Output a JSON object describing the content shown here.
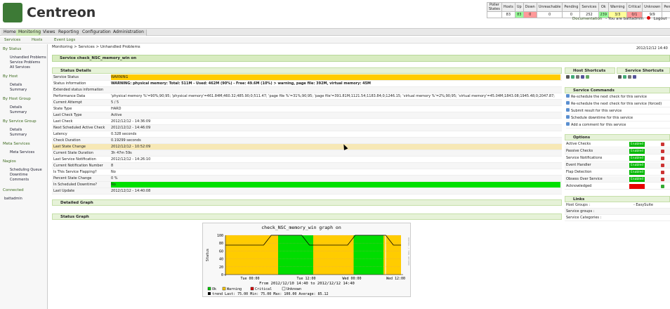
{
  "brand": {
    "name": "Centreon",
    "color": "#3d7a36"
  },
  "poller": {
    "headers": [
      "Poller States",
      "Hosts",
      "Up",
      "Down",
      "Unreachable",
      "Pending",
      "Services",
      "Ok",
      "Warning",
      "Critical",
      "Unknown",
      "Pending"
    ],
    "values": [
      "",
      "83",
      "83",
      "0",
      "0",
      "0",
      "252",
      "239",
      "3/3",
      "0/1",
      "9/9",
      "0"
    ]
  },
  "topbar": {
    "documentation": "Documentation",
    "you_are": "- You are battadmin",
    "logout": "Logout"
  },
  "menu": [
    "Home",
    "Monitoring",
    "Views",
    "Reporting",
    "Configuration",
    "Administration"
  ],
  "submenu": [
    "Services",
    "Hosts",
    "Event Logs"
  ],
  "sidebar": {
    "sections": [
      {
        "title": "By Status",
        "items": [
          "Unhandled Problems",
          "Service Problems",
          "All Services"
        ]
      },
      {
        "title": "By Host",
        "items": [
          "Details",
          "Summary"
        ]
      },
      {
        "title": "By Host Group",
        "items": [
          "Details",
          "Summary"
        ]
      },
      {
        "title": "By Service Group",
        "items": [
          "Details",
          "Summary"
        ]
      },
      {
        "title": "Meta Services",
        "items": [
          "Meta Services"
        ]
      },
      {
        "title": "Nagios",
        "items": [
          "Scheduling Queue",
          "Downtime",
          "Comments"
        ]
      }
    ],
    "connected": "Connected",
    "user": "battadmin"
  },
  "breadcrumb": "Monitoring > Services > Unhandled Problems",
  "datetime": "2012/12/12 14:40",
  "service_title": "Service check_NSC_memory_win on",
  "status_details": {
    "title": "Status Details",
    "rows": [
      {
        "k": "Service Status",
        "v": "WARNING",
        "style": "yellow"
      },
      {
        "k": "Status information",
        "v": "WARNING: physical memory: Total: 511M - Used: 462M (90%) - Free: 49.6M (10%) > warning, page file: 392M, virtual memory: 45M",
        "style": "w"
      },
      {
        "k": "Extended status information",
        "v": "",
        "style": "g"
      },
      {
        "k": "Performance Data",
        "v": "'physical memory %'=90%;90;95; 'physical memory'=461.84M;460.32;485.90;0;511.47; 'page file %'=31%;90;95; 'page file'=391.81M;1121.54;1183.84;0;1246.15; 'virtual memory %'=2%;90;95; 'virtual memory'=45.04M;1843.08;1945.48;0;2047.87;",
        "style": "w"
      },
      {
        "k": "Current Attempt",
        "v": "5 / 5",
        "style": "g"
      },
      {
        "k": "State Type",
        "v": "HARD",
        "style": "w"
      },
      {
        "k": "Last Check Type",
        "v": "Active",
        "style": "g"
      },
      {
        "k": "Last Check",
        "v": "2012/12/12 - 14:36:09",
        "style": "w"
      },
      {
        "k": "Next Scheduled Active Check",
        "v": "2012/12/12 - 14:46:09",
        "style": "g"
      },
      {
        "k": "Latency",
        "v": "0.328 seconds",
        "style": "w"
      },
      {
        "k": "Check Duration",
        "v": "0.19299 seconds",
        "style": "g"
      },
      {
        "k": "Last State Change",
        "v": "2012/12/12 - 10:52:09",
        "style": "yel2"
      },
      {
        "k": "Current State Duration",
        "v": "3h 47m 59s",
        "style": "g"
      },
      {
        "k": "Last Service Notification",
        "v": "2012/12/12 - 14:26:10",
        "style": "w"
      },
      {
        "k": "Current Notification Number",
        "v": "8",
        "style": "g"
      },
      {
        "k": "Is This Service Flapping?",
        "v": "No",
        "style": "w"
      },
      {
        "k": "Percent State Change",
        "v": "0 %",
        "style": "g"
      },
      {
        "k": "In Scheduled Downtime?",
        "v": "No",
        "style": "green"
      },
      {
        "k": "Last Update",
        "v": "2012/12/12 - 14:40:08",
        "style": "g"
      }
    ]
  },
  "detailed_graph": "Detailed Graph",
  "status_graph": "Status Graph",
  "host_shortcuts": "Host Shortcuts",
  "service_shortcuts": "Service Shortcuts",
  "service_commands": {
    "title": "Service Commands",
    "items": [
      "Re-schedule the next check for this service",
      "Re-schedule the next check for this service (forced)",
      "Submit result for this service",
      "Schedule downtime for this service",
      "Add a comment for this service"
    ]
  },
  "options": {
    "title": "Options",
    "items": [
      {
        "k": "Active Checks",
        "v": "Enabled",
        "on": true
      },
      {
        "k": "Passive Checks",
        "v": "Enabled",
        "on": true
      },
      {
        "k": "Service Notifications",
        "v": "Enabled",
        "on": true
      },
      {
        "k": "Event Handler",
        "v": "Enabled",
        "on": true
      },
      {
        "k": "Flap Detection",
        "v": "Enabled",
        "on": true
      },
      {
        "k": "Obsess Over Service",
        "v": "Enabled",
        "on": true
      },
      {
        "k": "Acknowledged",
        "v": "",
        "on": false
      }
    ]
  },
  "links": {
    "title": "Links",
    "items": [
      {
        "k": "Host Groups :",
        "v": "- EasySuite"
      },
      {
        "k": "Service groups :",
        "v": ""
      },
      {
        "k": "Service Categories :",
        "v": ""
      }
    ]
  },
  "graph": {
    "title": "check_NSC_memory_win graph on",
    "ylabel": "Status",
    "yticks": [
      "100",
      "80",
      "60",
      "40",
      "20",
      "0"
    ],
    "xticks": [
      "Tue 00:00",
      "Tue 12:00",
      "Wed 00:00",
      "Wed 12:00"
    ],
    "side_text": "RRDTOOL / TOBI OETIKER",
    "from_to": "From 2012/12/10 14:40 to 2012/12/12 14:40",
    "legend": [
      {
        "name": "Ok",
        "color": "#00cc00"
      },
      {
        "name": "Warning",
        "color": "#ffcc00"
      },
      {
        "name": "Critical",
        "color": "#dd0000"
      },
      {
        "name": "Unknown",
        "color": "#ffffff"
      }
    ],
    "trend": "trend   Last:   75.00   Min:   75.00   Max:  100.00   Average:   85.12"
  },
  "chart_data": {
    "type": "area",
    "ylim": [
      0,
      100
    ],
    "segments": [
      {
        "from": 0.0,
        "to": 0.3,
        "state": "Warning"
      },
      {
        "from": 0.3,
        "to": 0.5,
        "state": "Ok"
      },
      {
        "from": 0.5,
        "to": 0.73,
        "state": "Warning"
      },
      {
        "from": 0.73,
        "to": 0.9,
        "state": "Ok"
      },
      {
        "from": 0.9,
        "to": 0.92,
        "state": "Warning"
      },
      {
        "from": 0.92,
        "to": 1.0,
        "state": "Warning"
      }
    ],
    "trend_values": [
      75,
      75,
      75,
      75,
      75,
      75,
      100,
      100,
      100,
      100,
      100,
      75,
      75,
      75,
      75,
      75,
      75,
      100,
      100,
      100,
      100,
      100,
      75,
      75
    ]
  }
}
